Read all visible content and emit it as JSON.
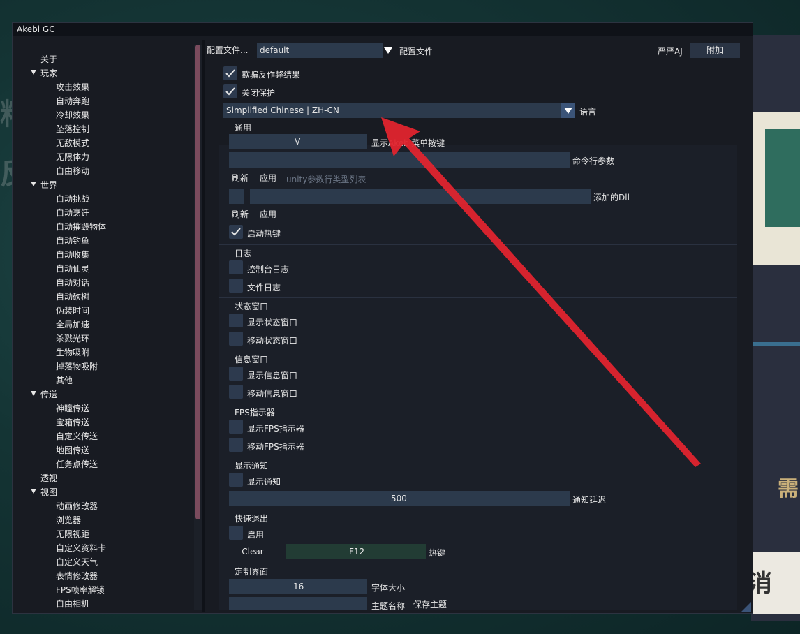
{
  "window": {
    "title": "Akebi GC"
  },
  "sidebar": {
    "items": [
      {
        "label": "关于",
        "level": 0,
        "expanded": null
      },
      {
        "label": "玩家",
        "level": 0,
        "expanded": true
      },
      {
        "label": "攻击效果",
        "level": 1
      },
      {
        "label": "自动奔跑",
        "level": 1
      },
      {
        "label": "冷却效果",
        "level": 1
      },
      {
        "label": "坠落控制",
        "level": 1
      },
      {
        "label": "无敌模式",
        "level": 1
      },
      {
        "label": "无限体力",
        "level": 1
      },
      {
        "label": "自由移动",
        "level": 1
      },
      {
        "label": "世界",
        "level": 0,
        "expanded": true
      },
      {
        "label": "自动挑战",
        "level": 1
      },
      {
        "label": "自动烹饪",
        "level": 1
      },
      {
        "label": "自动摧毁物体",
        "level": 1
      },
      {
        "label": "自动钓鱼",
        "level": 1
      },
      {
        "label": "自动收集",
        "level": 1
      },
      {
        "label": "自动仙灵",
        "level": 1
      },
      {
        "label": "自动对话",
        "level": 1
      },
      {
        "label": "自动砍树",
        "level": 1
      },
      {
        "label": "伪装时间",
        "level": 1
      },
      {
        "label": "全局加速",
        "level": 1
      },
      {
        "label": "杀戮光环",
        "level": 1
      },
      {
        "label": "生物吸附",
        "level": 1
      },
      {
        "label": "掉落物吸附",
        "level": 1
      },
      {
        "label": "其他",
        "level": 1
      },
      {
        "label": "传送",
        "level": 0,
        "expanded": true
      },
      {
        "label": "神瞳传送",
        "level": 1
      },
      {
        "label": "宝箱传送",
        "level": 1
      },
      {
        "label": "自定义传送",
        "level": 1
      },
      {
        "label": "地图传送",
        "level": 1
      },
      {
        "label": "任务点传送",
        "level": 1
      },
      {
        "label": "透视",
        "level": 0,
        "expanded": null
      },
      {
        "label": "视图",
        "level": 0,
        "expanded": true
      },
      {
        "label": "动画修改器",
        "level": 1
      },
      {
        "label": "浏览器",
        "level": 1
      },
      {
        "label": "无限视距",
        "level": 1
      },
      {
        "label": "自定义资料卡",
        "level": 1
      },
      {
        "label": "自定义天气",
        "level": 1
      },
      {
        "label": "表情修改器",
        "level": 1
      },
      {
        "label": "FPS帧率解锁",
        "level": 1
      },
      {
        "label": "自由相机",
        "level": 1
      }
    ]
  },
  "topbar": {
    "config_button": "配置文件...",
    "config_value": "default",
    "config_label": "配置文件",
    "right_label": "严严AJ",
    "attach_button": "附加"
  },
  "options": {
    "cheat_detect": "欺骗反作弊结果",
    "close_protect": "关闭保护",
    "language_value": "Simplified Chinese | ZH-CN",
    "language_label": "语言"
  },
  "general": {
    "title": "通用",
    "hotkey_value": "V",
    "hotkey_label": "显示Akebi菜单按键",
    "cmdline_label": "命令行参数",
    "refresh1": "刷新",
    "apply1": "应用",
    "hint1": "unity参数行类型列表",
    "dll_label": "添加的Dll",
    "refresh2": "刷新",
    "apply2": "应用",
    "enable_hotkey": "启动热键"
  },
  "log": {
    "title": "日志",
    "console": "控制台日志",
    "file": "文件日志"
  },
  "status": {
    "title": "状态窗口",
    "show": "显示状态窗口",
    "move": "移动状态窗口"
  },
  "info": {
    "title": "信息窗口",
    "show": "显示信息窗口",
    "move": "移动信息窗口"
  },
  "fps": {
    "title": "FPS指示器",
    "show": "显示FPS指示器",
    "move": "移动FPS指示器"
  },
  "notify": {
    "title": "显示通知",
    "show": "显示通知",
    "delay_value": "500",
    "delay_label": "通知延迟"
  },
  "quit": {
    "title": "快速退出",
    "enable": "启用",
    "clear_button": "Clear",
    "key_value": "F12",
    "key_label": "热键"
  },
  "custom": {
    "title": "定制界面",
    "font_size_value": "16",
    "font_size_label": "字体大小",
    "theme_label": "主题名称",
    "save_theme": "保存主题"
  },
  "background": {
    "right_glyph": "需",
    "right_glyph2": "消",
    "left_glyphs": [
      "料",
      "反"
    ]
  },
  "colors": {
    "accent": "#3b5478",
    "arrow": "#e0242e",
    "checkbox": "#2d3a4e",
    "field": "#2c3a4c",
    "scrollbar": "#7a4b5d"
  }
}
